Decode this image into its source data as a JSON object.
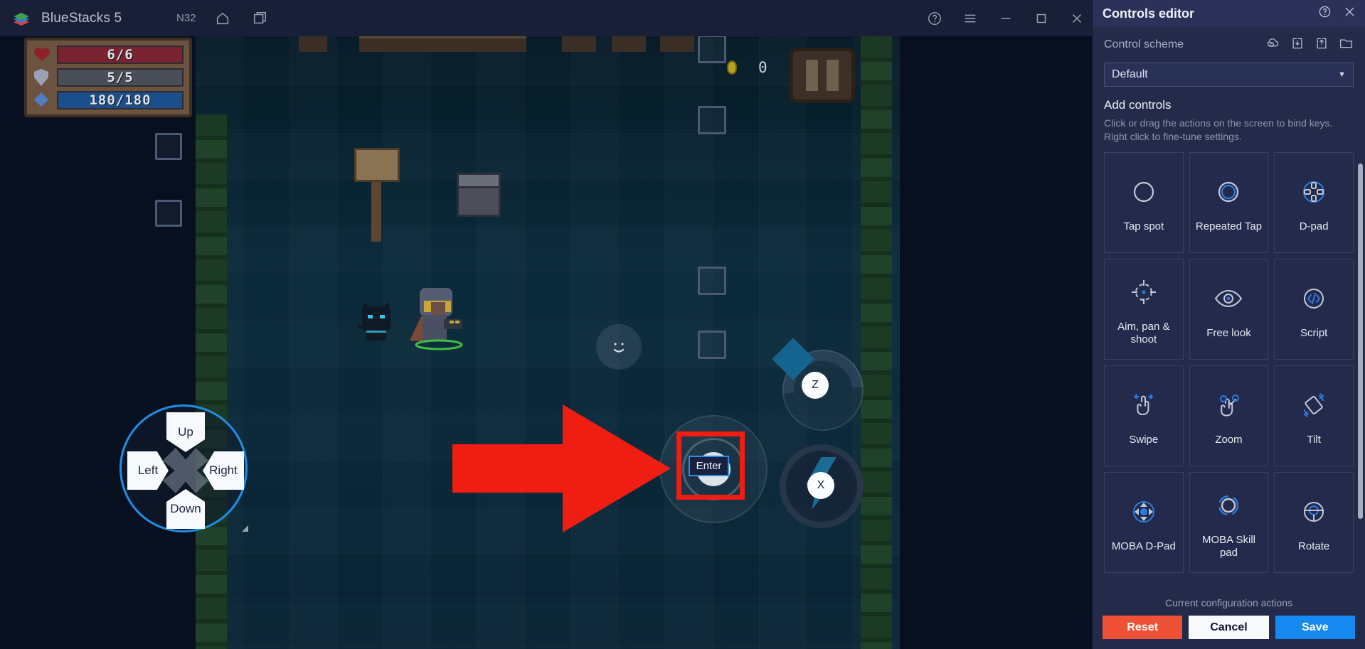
{
  "titlebar": {
    "app_name": "BlueStacks 5",
    "instance_label": "N32",
    "logo_icon": "bluestacks-logo",
    "home_icon": "home-icon",
    "multi_instance_icon": "multi-instance-icon",
    "help_icon": "help-circle-icon",
    "menu_icon": "hamburger-menu-icon",
    "minimize_icon": "minimize-icon",
    "maximize_icon": "maximize-icon",
    "close_icon": "close-icon"
  },
  "game": {
    "hud": {
      "health": "6/6",
      "shield": "5/5",
      "mana": "180/180",
      "health_icon": "heart-icon",
      "shield_icon": "shield-icon",
      "mana_icon": "gem-icon"
    },
    "coin_icon": "coin-icon",
    "coin_count": "0",
    "pause_icon": "pause-icon",
    "overlays": {
      "dpad": {
        "name": "D-pad",
        "up": "Up",
        "down": "Down",
        "left": "Left",
        "right": "Right"
      },
      "enter_button": "Enter",
      "z_button": "Z",
      "x_button": "X",
      "tap_spot_icon": "smiley-tap-icon"
    },
    "annotation": {
      "arrow_icon": "red-arrow-pointer",
      "highlight_color": "#f01d12",
      "highlight_target": "Enter"
    }
  },
  "panel": {
    "title": "Controls editor",
    "help_icon": "help-circle-icon",
    "close_icon": "close-icon",
    "scheme": {
      "label": "Control scheme",
      "selected": "Default",
      "caret_icon": "chevron-down-icon",
      "icons": [
        {
          "name": "cloud-restore-icon"
        },
        {
          "name": "import-icon"
        },
        {
          "name": "export-icon"
        },
        {
          "name": "folder-icon"
        }
      ]
    },
    "add_controls": {
      "title": "Add controls",
      "description": "Click or drag the actions on the screen to bind keys. Right click to fine-tune settings."
    },
    "controls": [
      {
        "label": "Tap spot",
        "icon": "tap-spot-icon"
      },
      {
        "label": "Repeated Tap",
        "icon": "repeated-tap-icon"
      },
      {
        "label": "D-pad",
        "icon": "dpad-icon"
      },
      {
        "label": "Aim, pan & shoot",
        "icon": "aim-pan-shoot-icon"
      },
      {
        "label": "Free look",
        "icon": "free-look-icon"
      },
      {
        "label": "Script",
        "icon": "script-icon"
      },
      {
        "label": "Swipe",
        "icon": "swipe-icon"
      },
      {
        "label": "Zoom",
        "icon": "zoom-icon"
      },
      {
        "label": "Tilt",
        "icon": "tilt-icon"
      },
      {
        "label": "MOBA D-Pad",
        "icon": "moba-dpad-icon"
      },
      {
        "label": "MOBA Skill pad",
        "icon": "moba-skill-pad-icon"
      },
      {
        "label": "Rotate",
        "icon": "rotate-icon"
      }
    ],
    "footer": {
      "note": "Current configuration actions",
      "reset": "Reset",
      "cancel": "Cancel",
      "save": "Save"
    },
    "colors": {
      "panel_bg": "#242a49",
      "header_bg": "#2b3158",
      "tile_bg": "#232a4c",
      "accent_blue": "#1589ef",
      "reset_red": "#ef5137"
    }
  }
}
